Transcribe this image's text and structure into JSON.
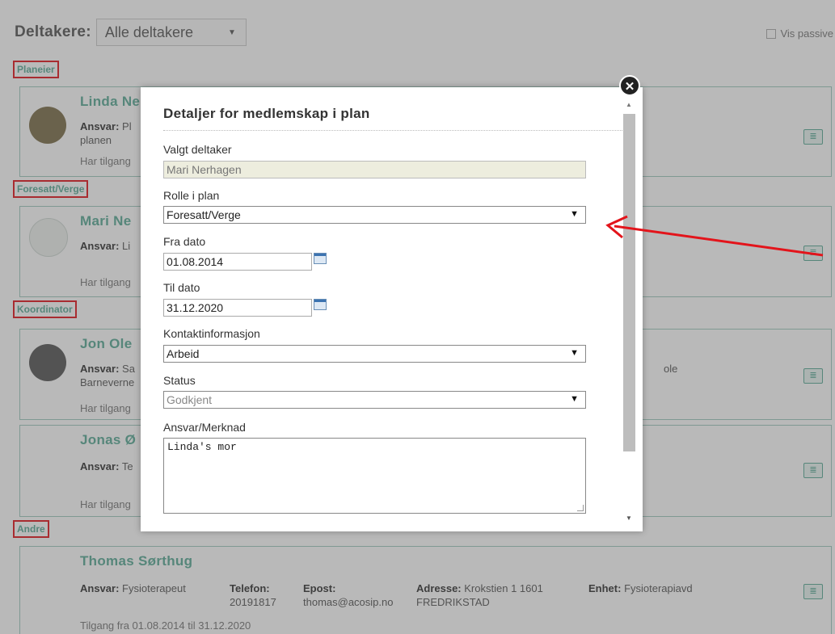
{
  "header": {
    "participants_label": "Deltakere:",
    "participants_select": "Alle deltakere",
    "show_passive": "Vis passive"
  },
  "sections": {
    "owner": "Planeier",
    "guardian": "Foresatt/Verge",
    "coordinator": "Koordinator",
    "others": "Andre"
  },
  "cards": {
    "linda": {
      "name": "Linda Ne",
      "ansvar_label": "Ansvar:",
      "ansvar": "Pl",
      "line2": "planen",
      "access": "Har tilgang"
    },
    "mari": {
      "name": "Mari Ne",
      "ansvar_label": "Ansvar:",
      "ansvar": "Li",
      "access": "Har tilgang"
    },
    "jon": {
      "name": "Jon Ole",
      "ansvar_label": "Ansvar:",
      "ansvar": "Sa",
      "line2": "Barneverne",
      "access": "Har tilgang",
      "tail": "ole"
    },
    "jonas": {
      "name": "Jonas Ø",
      "ansvar_label": "Ansvar:",
      "ansvar": "Te",
      "access": "Har tilgang"
    },
    "thomas": {
      "name": "Thomas Sørthug",
      "ansvar_label": "Ansvar:",
      "ansvar": "Fysioterapeut",
      "telefon_label": "Telefon:",
      "telefon": "20191817",
      "epost_label": "Epost:",
      "epost": "thomas@acosip.no",
      "adresse_label": "Adresse:",
      "adresse": "Krokstien 1 1601 FREDRIKSTAD",
      "enhet_label": "Enhet:",
      "enhet": "Fysioterapiavd",
      "access": "Tilgang fra 01.08.2014 til 31.12.2020"
    }
  },
  "modal": {
    "title": "Detaljer for medlemskap i plan",
    "fields": {
      "participant_label": "Valgt deltaker",
      "participant_value": "Mari Nerhagen",
      "role_label": "Rolle i plan",
      "role_value": "Foresatt/Verge",
      "from_label": "Fra dato",
      "from_value": "01.08.2014",
      "to_label": "Til dato",
      "to_value": "31.12.2020",
      "contact_label": "Kontaktinformasjon",
      "contact_value": "Arbeid",
      "status_label": "Status",
      "status_value": "Godkjent",
      "note_label": "Ansvar/Merknad",
      "note_value": "Linda's mor"
    }
  },
  "colors": {
    "accent": "#5aab97",
    "highlight_red": "#e3141b"
  }
}
